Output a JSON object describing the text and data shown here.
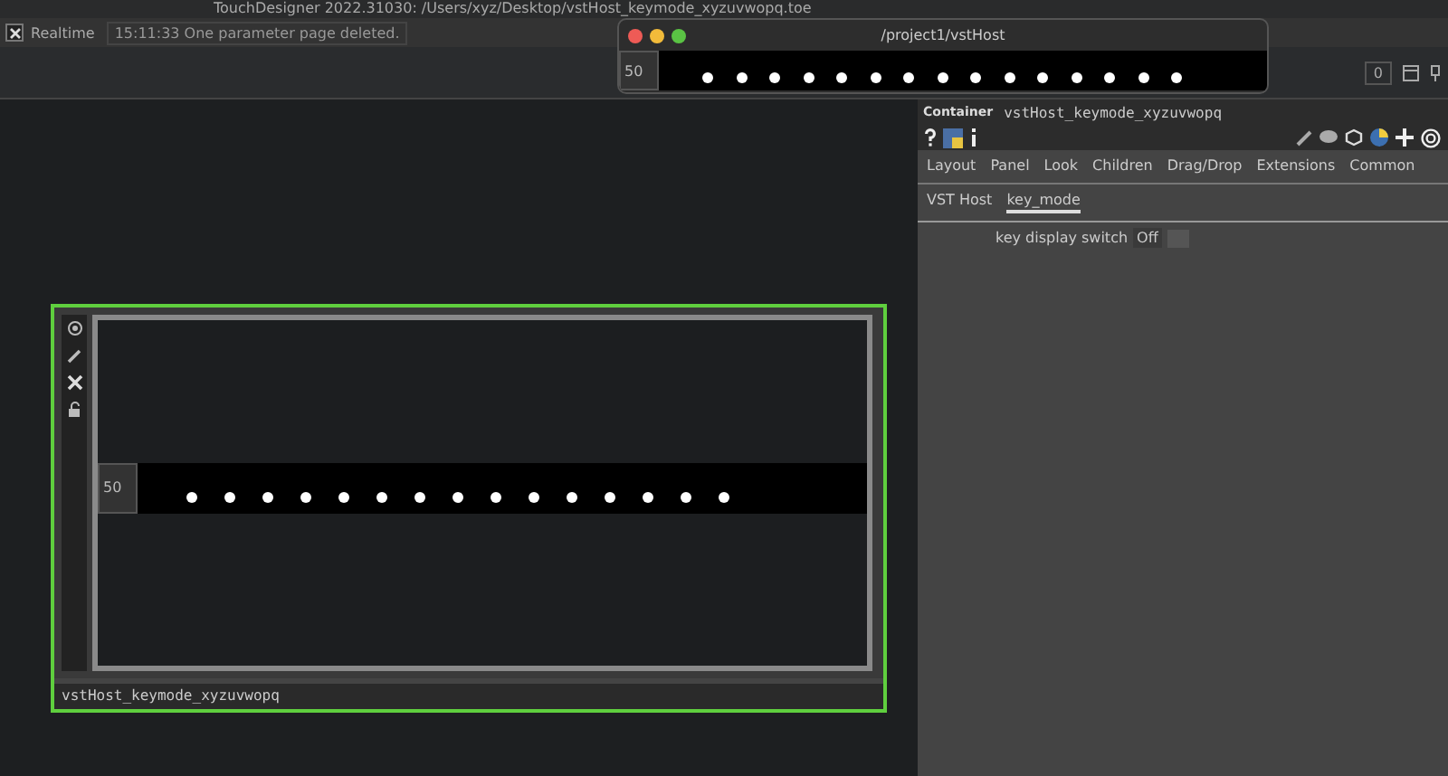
{
  "app_title": "TouchDesigner 2022.31030: /Users/xyz/Desktop/vstHost_keymode_xyzuvwopq.toe",
  "status_bar": {
    "realtime": {
      "label": "Realtime",
      "checked": true
    },
    "message": "15:11:33 One parameter page deleted."
  },
  "toolbar": {
    "counter": "0"
  },
  "viewer_window": {
    "title": "/project1/vstHost",
    "slider_value": "50"
  },
  "node": {
    "name": "vstHost_keymode_xyzuvwopq",
    "selected": true,
    "slider_value": "50"
  },
  "parameters": {
    "type": "Container",
    "name": "vstHost_keymode_xyzuvwopq",
    "pages": [
      {
        "label": "Layout",
        "selected": false
      },
      {
        "label": "Panel",
        "selected": false
      },
      {
        "label": "Look",
        "selected": false
      },
      {
        "label": "Children",
        "selected": false
      },
      {
        "label": "Drag/Drop",
        "selected": false
      },
      {
        "label": "Extensions",
        "selected": false
      },
      {
        "label": "Common",
        "selected": false
      }
    ],
    "custom_pages": [
      {
        "label": "VST Host",
        "selected": false
      },
      {
        "label": "key_mode",
        "selected": true
      }
    ],
    "rows": [
      {
        "label": "key display switch",
        "value": "Off"
      }
    ]
  }
}
